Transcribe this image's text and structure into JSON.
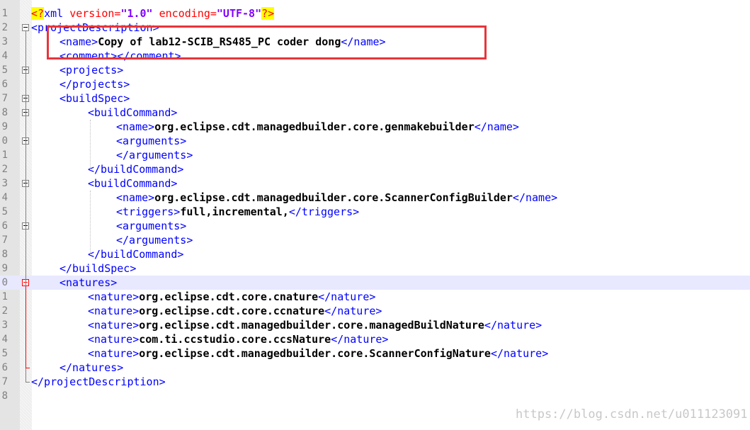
{
  "line_numbers": [
    "1",
    "2",
    "3",
    "4",
    "5",
    "6",
    "7",
    "8",
    "9",
    "0",
    "1",
    "2",
    "3",
    "4",
    "5",
    "6",
    "7",
    "8",
    "9",
    "0",
    "1",
    "2",
    "3",
    "4",
    "5",
    "6",
    "7",
    "8"
  ],
  "lines": [
    {
      "parts": [
        [
          "pi",
          "<?"
        ],
        [
          "tag",
          "xml "
        ],
        [
          "kw",
          "version="
        ],
        [
          "str",
          "\"1.0\""
        ],
        [
          "kw",
          " encoding="
        ],
        [
          "str",
          "\"UTF-8\""
        ],
        [
          "pi",
          "?>"
        ]
      ]
    },
    {
      "parts": [
        [
          "tag",
          "<projectDescription>"
        ]
      ]
    },
    {
      "parts": [
        [
          "tag",
          "<name>"
        ],
        [
          "txt",
          "Copy of lab12-SCIB_RS485_PC coder dong"
        ],
        [
          "tag",
          "</name>"
        ]
      ]
    },
    {
      "parts": [
        [
          "tag",
          "<comment></comment>"
        ]
      ]
    },
    {
      "parts": [
        [
          "tag",
          "<projects>"
        ]
      ]
    },
    {
      "parts": [
        [
          "tag",
          "</projects>"
        ]
      ]
    },
    {
      "parts": [
        [
          "tag",
          "<buildSpec>"
        ]
      ]
    },
    {
      "parts": [
        [
          "tag",
          "<buildCommand>"
        ]
      ]
    },
    {
      "parts": [
        [
          "tag",
          "<name>"
        ],
        [
          "txt",
          "org.eclipse.cdt.managedbuilder.core.genmakebuilder"
        ],
        [
          "tag",
          "</name>"
        ]
      ]
    },
    {
      "parts": [
        [
          "tag",
          "<arguments>"
        ]
      ]
    },
    {
      "parts": [
        [
          "tag",
          "</arguments>"
        ]
      ]
    },
    {
      "parts": [
        [
          "tag",
          "</buildCommand>"
        ]
      ]
    },
    {
      "parts": [
        [
          "tag",
          "<buildCommand>"
        ]
      ]
    },
    {
      "parts": [
        [
          "tag",
          "<name>"
        ],
        [
          "txt",
          "org.eclipse.cdt.managedbuilder.core.ScannerConfigBuilder"
        ],
        [
          "tag",
          "</name>"
        ]
      ]
    },
    {
      "parts": [
        [
          "tag",
          "<triggers>"
        ],
        [
          "txt",
          "full,incremental,"
        ],
        [
          "tag",
          "</triggers>"
        ]
      ]
    },
    {
      "parts": [
        [
          "tag",
          "<arguments>"
        ]
      ]
    },
    {
      "parts": [
        [
          "tag",
          "</arguments>"
        ]
      ]
    },
    {
      "parts": [
        [
          "tag",
          "</buildCommand>"
        ]
      ]
    },
    {
      "parts": [
        [
          "tag",
          "</buildSpec>"
        ]
      ]
    },
    {
      "parts": [
        [
          "tag",
          "<natures>"
        ]
      ]
    },
    {
      "parts": [
        [
          "tag",
          "<nature>"
        ],
        [
          "txt",
          "org.eclipse.cdt.core.cnature"
        ],
        [
          "tag",
          "</nature>"
        ]
      ]
    },
    {
      "parts": [
        [
          "tag",
          "<nature>"
        ],
        [
          "txt",
          "org.eclipse.cdt.core.ccnature"
        ],
        [
          "tag",
          "</nature>"
        ]
      ]
    },
    {
      "parts": [
        [
          "tag",
          "<nature>"
        ],
        [
          "txt",
          "org.eclipse.cdt.managedbuilder.core.managedBuildNature"
        ],
        [
          "tag",
          "</nature>"
        ]
      ]
    },
    {
      "parts": [
        [
          "tag",
          "<nature>"
        ],
        [
          "txt",
          "com.ti.ccstudio.core.ccsNature"
        ],
        [
          "tag",
          "</nature>"
        ]
      ]
    },
    {
      "parts": [
        [
          "tag",
          "<nature>"
        ],
        [
          "txt",
          "org.eclipse.cdt.managedbuilder.core.ScannerConfigNature"
        ],
        [
          "tag",
          "</nature>"
        ]
      ]
    },
    {
      "parts": [
        [
          "tag",
          "</natures>"
        ]
      ]
    },
    {
      "parts": [
        [
          "tag",
          "</projectDescription>"
        ]
      ]
    },
    {
      "parts": []
    }
  ],
  "current_line": 20,
  "fold_markers": [
    "collapse-icon",
    "collapse-icon",
    "collapse-icon",
    "collapse-icon",
    "collapse-icon",
    "collapse-icon"
  ],
  "watermark": "https://blog.csdn.net/u011123091",
  "colors": {
    "tag": "#0000ff",
    "text": "#000000",
    "attr": "#ff0000",
    "string": "#8000ff",
    "highlight_box": "#e8343a"
  }
}
